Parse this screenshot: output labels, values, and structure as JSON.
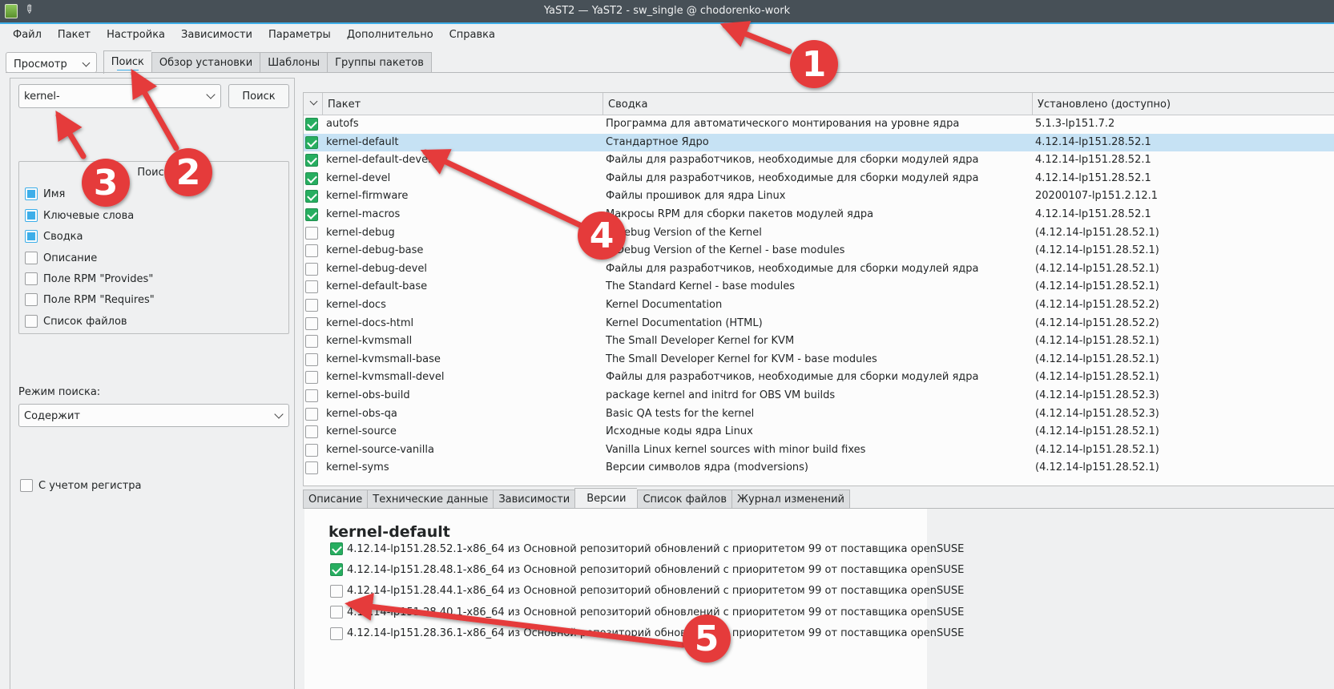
{
  "window": {
    "title": "YaST2 — YaST2 - sw_single @ chodorenko-work"
  },
  "menu": [
    "Файл",
    "Пакет",
    "Настройка",
    "Зависимости",
    "Параметры",
    "Дополнительно",
    "Справка"
  ],
  "top_tabs": {
    "view_dropdown": "Просмотр",
    "tabs": [
      "Поиск",
      "Обзор установки",
      "Шаблоны",
      "Группы пакетов"
    ]
  },
  "search": {
    "query": "kernel-",
    "button_label": "Поиск",
    "group_title": "Поиск",
    "options": [
      {
        "label": "Имя",
        "checked": true
      },
      {
        "label": "Ключевые слова",
        "checked": true
      },
      {
        "label": "Сводка",
        "checked": true
      },
      {
        "label": "Описание",
        "checked": false
      },
      {
        "label": "Поле RPM \"Provides\"",
        "checked": false
      },
      {
        "label": "Поле RPM \"Requires\"",
        "checked": false
      },
      {
        "label": "Список файлов",
        "checked": false
      }
    ],
    "mode_label": "Режим поиска:",
    "mode_value": "Содержит",
    "case_label": "С учетом регистра"
  },
  "table": {
    "columns": [
      "Пакет",
      "Сводка",
      "Установлено (доступно)"
    ],
    "rows": [
      {
        "checked": true,
        "name": "autofs",
        "summary": "Программа для автоматического монтирования на уровне ядра",
        "version": "5.1.3-lp151.7.2"
      },
      {
        "checked": true,
        "name": "kernel-default",
        "summary": "Стандартное Ядро",
        "version": "4.12.14-lp151.28.52.1",
        "selected": true
      },
      {
        "checked": true,
        "name": "kernel-default-devel",
        "summary": "Файлы для разработчиков, необходимые для сборки модулей ядра",
        "version": "4.12.14-lp151.28.52.1"
      },
      {
        "checked": true,
        "name": "kernel-devel",
        "summary": "Файлы для разработчиков, необходимые для сборки модулей ядра",
        "version": "4.12.14-lp151.28.52.1"
      },
      {
        "checked": true,
        "name": "kernel-firmware",
        "summary": "Файлы прошивок для ядра Linux",
        "version": "20200107-lp151.2.12.1"
      },
      {
        "checked": true,
        "name": "kernel-macros",
        "summary": "Макросы RPM для сборки пакетов модулей ядра",
        "version": "4.12.14-lp151.28.52.1"
      },
      {
        "checked": false,
        "name": "kernel-debug",
        "summary": "A Debug Version of the Kernel",
        "version": "(4.12.14-lp151.28.52.1)"
      },
      {
        "checked": false,
        "name": "kernel-debug-base",
        "summary": "A Debug Version of the Kernel - base modules",
        "version": "(4.12.14-lp151.28.52.1)"
      },
      {
        "checked": false,
        "name": "kernel-debug-devel",
        "summary": "Файлы для разработчиков, необходимые для сборки модулей ядра",
        "version": "(4.12.14-lp151.28.52.1)"
      },
      {
        "checked": false,
        "name": "kernel-default-base",
        "summary": "The Standard Kernel - base modules",
        "version": "(4.12.14-lp151.28.52.1)"
      },
      {
        "checked": false,
        "name": "kernel-docs",
        "summary": "Kernel Documentation",
        "version": "(4.12.14-lp151.28.52.2)"
      },
      {
        "checked": false,
        "name": "kernel-docs-html",
        "summary": "Kernel Documentation (HTML)",
        "version": "(4.12.14-lp151.28.52.2)"
      },
      {
        "checked": false,
        "name": "kernel-kvmsmall",
        "summary": "The Small Developer Kernel for KVM",
        "version": "(4.12.14-lp151.28.52.1)"
      },
      {
        "checked": false,
        "name": "kernel-kvmsmall-base",
        "summary": "The Small Developer Kernel for KVM - base modules",
        "version": "(4.12.14-lp151.28.52.1)"
      },
      {
        "checked": false,
        "name": "kernel-kvmsmall-devel",
        "summary": "Файлы для разработчиков, необходимые для сборки модулей ядра",
        "version": "(4.12.14-lp151.28.52.1)"
      },
      {
        "checked": false,
        "name": "kernel-obs-build",
        "summary": "package kernel and initrd for OBS VM builds",
        "version": "(4.12.14-lp151.28.52.3)"
      },
      {
        "checked": false,
        "name": "kernel-obs-qa",
        "summary": "Basic QA tests for the kernel",
        "version": "(4.12.14-lp151.28.52.3)"
      },
      {
        "checked": false,
        "name": "kernel-source",
        "summary": "Исходные коды ядра Linux",
        "version": "(4.12.14-lp151.28.52.1)"
      },
      {
        "checked": false,
        "name": "kernel-source-vanilla",
        "summary": "Vanilla Linux kernel sources with minor build fixes",
        "version": "(4.12.14-lp151.28.52.1)"
      },
      {
        "checked": false,
        "name": "kernel-syms",
        "summary": "Версии символов ядра (modversions)",
        "version": "(4.12.14-lp151.28.52.1)"
      }
    ]
  },
  "details": {
    "tabs": [
      "Описание",
      "Технические данные",
      "Зависимости",
      "Версии",
      "Список файлов",
      "Журнал изменений"
    ],
    "active_tab": "Версии",
    "package_title": "kernel-default",
    "versions": [
      {
        "checked": true,
        "text": "4.12.14-lp151.28.52.1-x86_64 из Основной репозиторий обновлений с приоритетом 99 от поставщика openSUSE"
      },
      {
        "checked": true,
        "text": "4.12.14-lp151.28.48.1-x86_64 из Основной репозиторий обновлений с приоритетом 99 от поставщика openSUSE"
      },
      {
        "checked": false,
        "text": "4.12.14-lp151.28.44.1-x86_64 из Основной репозиторий обновлений с приоритетом 99 от поставщика openSUSE"
      },
      {
        "checked": false,
        "text": "4.12.14-lp151.28.40.1-x86_64 из Основной репозиторий обновлений с приоритетом 99 от поставщика openSUSE"
      },
      {
        "checked": false,
        "text": "4.12.14-lp151.28.36.1-x86_64 из Основной репозиторий обновлений с приоритетом 99 от поставщика openSUSE"
      }
    ]
  },
  "annotations": {
    "labels": [
      "1",
      "2",
      "3",
      "4",
      "5"
    ],
    "color": "#e53b3b"
  }
}
